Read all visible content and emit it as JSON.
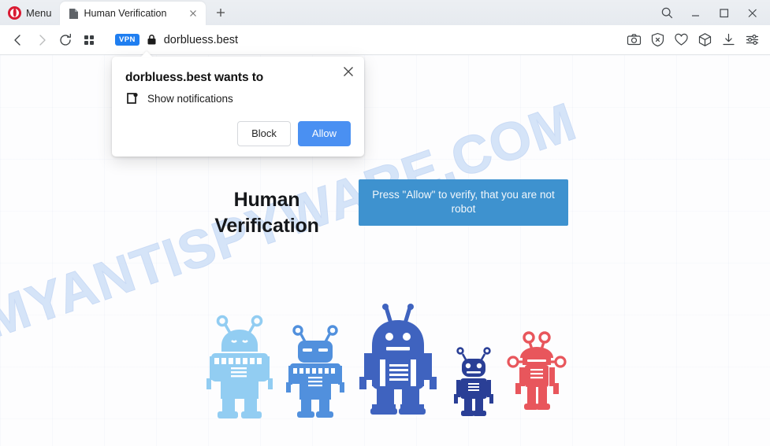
{
  "browser": {
    "menu_label": "Menu",
    "logo_icon": "opera-logo-icon",
    "tab": {
      "title": "Human Verification",
      "favicon": "page-document-icon",
      "close_icon": "close-icon"
    },
    "new_tab_icon": "plus-icon",
    "window_controls": {
      "search_icon": "search-icon",
      "minimize_icon": "minimize-icon",
      "maximize_icon": "maximize-icon",
      "close_icon": "close-icon"
    },
    "navigation": {
      "back_icon": "chevron-left-icon",
      "forward_icon": "chevron-right-icon",
      "reload_icon": "reload-icon",
      "tiles_icon": "grid-tiles-icon"
    },
    "address": {
      "vpn_badge": "VPN",
      "lock_icon": "padlock-icon",
      "url": "dorbluess.best"
    },
    "toolbar_icons": [
      "camera-snapshot-icon",
      "ad-blocker-shield-icon",
      "heart-icon",
      "cube-icon",
      "download-icon",
      "easy-setup-sliders-icon"
    ]
  },
  "dialog": {
    "title": "dorbluess.best wants to",
    "permission_icon": "notification-bell-badge-icon",
    "permission_label": "Show notifications",
    "close_icon": "close-icon",
    "block_label": "Block",
    "allow_label": "Allow"
  },
  "page": {
    "watermark": "MYANTISPYWARE.COM",
    "heading_line1": "Human",
    "heading_line2": "Verification",
    "banner_text": "Press \"Allow\" to verify, that you are not robot",
    "robots": [
      {
        "name": "robot-light-blue",
        "color": "#92cdf2"
      },
      {
        "name": "robot-medium-blue",
        "color": "#5190dd"
      },
      {
        "name": "robot-royal-blue",
        "color": "#3f63bf"
      },
      {
        "name": "robot-navy-small",
        "color": "#2a3f96"
      },
      {
        "name": "robot-red",
        "color": "#e8565c"
      }
    ]
  },
  "colors": {
    "opera_red": "#d91a32",
    "allow_blue": "#4a90f2",
    "vpn_blue": "#1f7ef0",
    "banner_blue": "#3e92cf",
    "watermark_blue": "#cfe0f7"
  }
}
